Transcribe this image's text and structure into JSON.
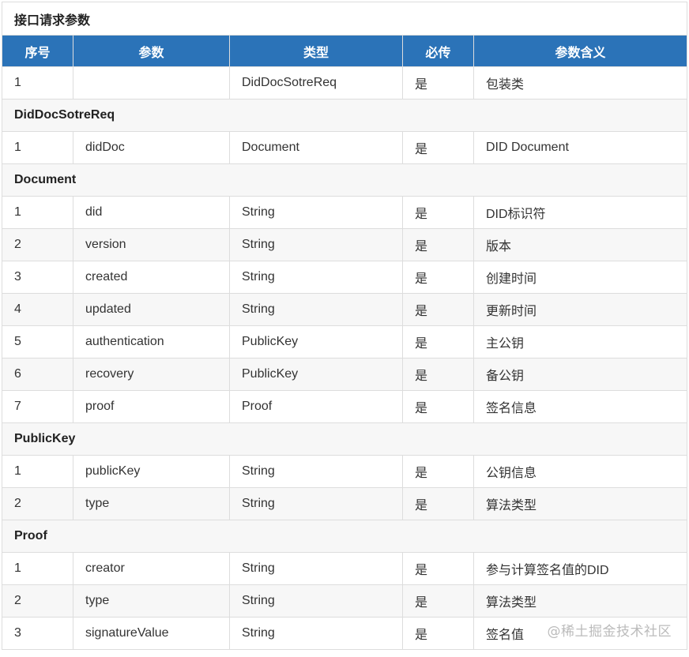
{
  "title": "接口请求参数",
  "headers": [
    "序号",
    "参数",
    "类型",
    "必传",
    "参数含义"
  ],
  "rows": [
    {
      "kind": "data",
      "cells": [
        "1",
        "",
        "DidDocSotreReq",
        "是",
        "包装类"
      ]
    },
    {
      "kind": "section",
      "label": "DidDocSotreReq"
    },
    {
      "kind": "data",
      "cells": [
        "1",
        "didDoc",
        "Document",
        "是",
        "DID Document"
      ]
    },
    {
      "kind": "section",
      "label": "Document"
    },
    {
      "kind": "data",
      "cells": [
        "1",
        "did",
        "String",
        "是",
        "DID标识符"
      ]
    },
    {
      "kind": "data",
      "cells": [
        "2",
        "version",
        "String",
        "是",
        "版本"
      ]
    },
    {
      "kind": "data",
      "cells": [
        "3",
        "created",
        "String",
        "是",
        "创建时间"
      ]
    },
    {
      "kind": "data",
      "cells": [
        "4",
        "updated",
        "String",
        "是",
        "更新时间"
      ]
    },
    {
      "kind": "data",
      "cells": [
        "5",
        "authentication",
        "PublicKey",
        "是",
        "主公钥"
      ]
    },
    {
      "kind": "data",
      "cells": [
        "6",
        "recovery",
        "PublicKey",
        "是",
        "备公钥"
      ]
    },
    {
      "kind": "data",
      "cells": [
        "7",
        "proof",
        "Proof",
        "是",
        "签名信息"
      ]
    },
    {
      "kind": "section",
      "label": "PublicKey"
    },
    {
      "kind": "data",
      "cells": [
        "1",
        "publicKey",
        "String",
        "是",
        "公钥信息"
      ]
    },
    {
      "kind": "data",
      "cells": [
        "2",
        "type",
        "String",
        "是",
        "算法类型"
      ]
    },
    {
      "kind": "section",
      "label": "Proof"
    },
    {
      "kind": "data",
      "cells": [
        "1",
        "creator",
        "String",
        "是",
        "参与计算签名值的DID"
      ]
    },
    {
      "kind": "data",
      "cells": [
        "2",
        "type",
        "String",
        "是",
        "算法类型"
      ]
    },
    {
      "kind": "data",
      "cells": [
        "3",
        "signatureValue",
        "String",
        "是",
        "签名值"
      ]
    }
  ],
  "watermark": "@稀土掘金技术社区",
  "colors": {
    "header_bg": "#2b73b8",
    "header_text": "#ffffff",
    "alt_row_bg": "#f7f7f7",
    "border": "#dddddd"
  }
}
